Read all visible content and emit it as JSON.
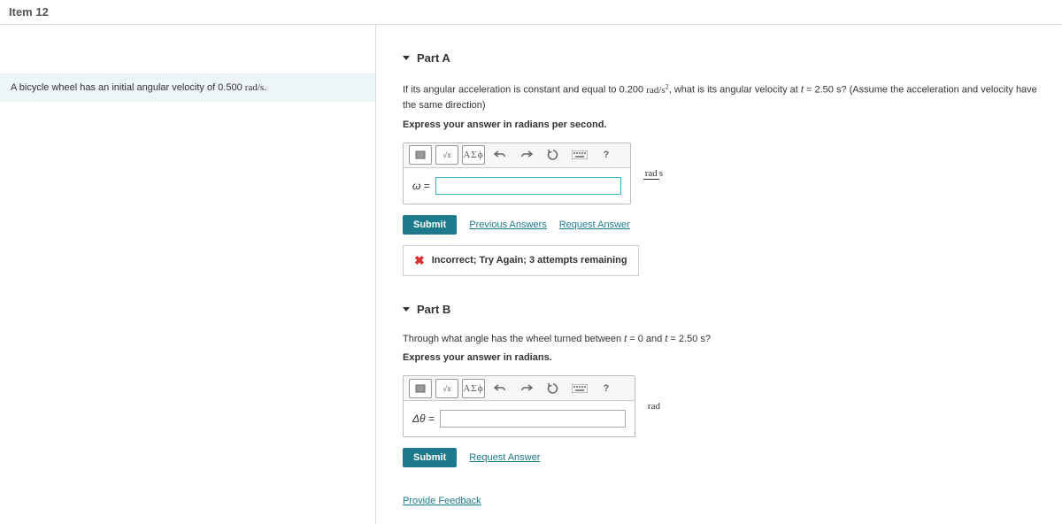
{
  "topbar": {
    "title": "Item 12"
  },
  "problem": {
    "statement_html": "A bicycle wheel has an initial angular velocity of 0.500 <span class='rad-unit'>rad/s</span>."
  },
  "partA": {
    "header": "Part A",
    "question_html": "If its angular acceleration is constant and equal to 0.200 <span class='rad-unit'>rad/s<sup>2</sup></span>, what is its angular velocity at <i>t</i> = 2.50 s? (Assume the acceleration and velocity have the same direction)",
    "instruct": "Express your answer in radians per second.",
    "toolbar": {
      "templates": "ΑΣϕ",
      "help": "?"
    },
    "var": "ω =",
    "unit_top": "rad",
    "unit_bottom": "s",
    "submit": "Submit",
    "prev_answers": "Previous Answers",
    "request_answer": "Request Answer",
    "feedback": "Incorrect; Try Again; 3 attempts remaining"
  },
  "partB": {
    "header": "Part B",
    "question_html": "Through what angle has the wheel turned between <i>t</i> = 0 and <i>t</i> = 2.50 s?",
    "instruct": "Express your answer in radians.",
    "toolbar": {
      "templates": "ΑΣϕ",
      "help": "?"
    },
    "var": "Δθ =",
    "unit": "rad",
    "submit": "Submit",
    "request_answer": "Request Answer"
  },
  "footer": {
    "provide_feedback": "Provide Feedback"
  }
}
